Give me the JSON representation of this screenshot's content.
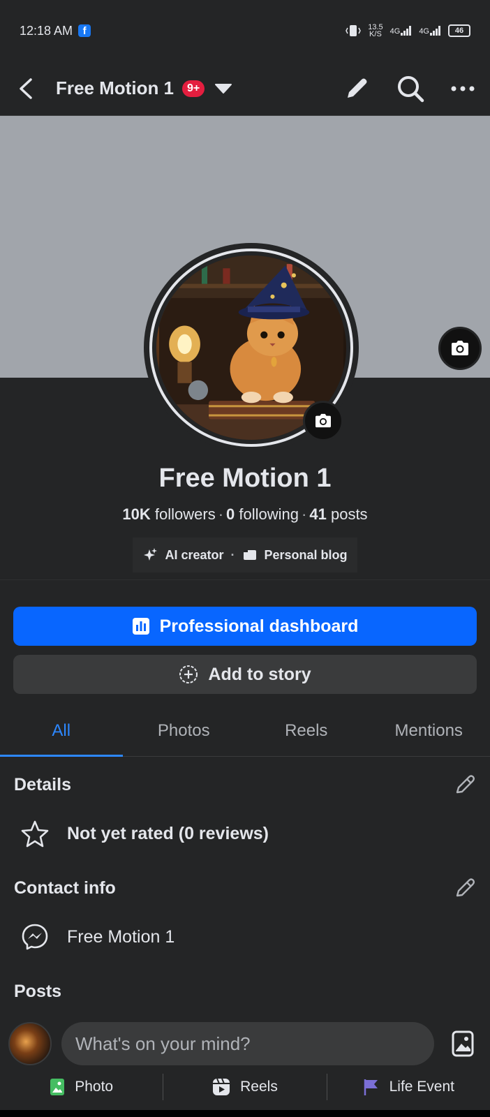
{
  "status_bar": {
    "time": "12:18 AM",
    "network_speed": "13.5\nK/S",
    "network1": "4G",
    "network2": "4G",
    "battery": "46"
  },
  "top_nav": {
    "title": "Free Motion 1",
    "notification_badge": "9+"
  },
  "profile": {
    "name": "Free Motion 1",
    "followers_count": "10K",
    "followers_label": "followers",
    "following_count": "0",
    "following_label": "following",
    "posts_count": "41",
    "posts_label": "posts",
    "tag1": "AI creator",
    "tag2": "Personal blog"
  },
  "buttons": {
    "professional_dashboard": "Professional dashboard",
    "add_to_story": "Add to story"
  },
  "tabs": [
    {
      "label": "All",
      "active": true
    },
    {
      "label": "Photos",
      "active": false
    },
    {
      "label": "Reels",
      "active": false
    },
    {
      "label": "Mentions",
      "active": false
    }
  ],
  "details": {
    "title": "Details",
    "rating": "Not yet rated (0 reviews)"
  },
  "contact": {
    "title": "Contact info",
    "messenger": "Free Motion 1"
  },
  "posts": {
    "title": "Posts",
    "composer_placeholder": "What's on your mind?",
    "actions": [
      "Photo",
      "Reels",
      "Life Event"
    ]
  },
  "colors": {
    "accent": "#0866ff",
    "background": "#242526",
    "badge": "#e41e3f",
    "photo_icon": "#45bd62",
    "life_event_icon": "#7b6fd6"
  }
}
